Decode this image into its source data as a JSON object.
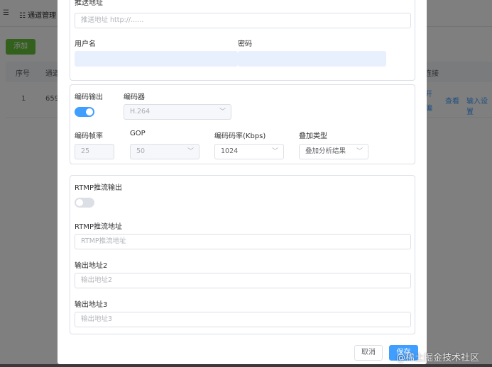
{
  "background": {
    "menu_icon": "☰",
    "tab_label": "☷ 通道管理",
    "add_button": "添加",
    "table_headers": [
      "序号",
      "通道"
    ],
    "right_header": "连接",
    "row": {
      "index": "1",
      "id_partial": "659"
    },
    "row_actions": [
      "查看",
      "输入设置"
    ],
    "right_links": [
      "开",
      "编"
    ]
  },
  "dialog": {
    "push": {
      "push_url_label": "推送地址",
      "push_url_placeholder": "推送地址 http://......",
      "username_label": "用户名",
      "password_label": "密码"
    },
    "encode": {
      "encode_output_label": "编码输出",
      "encode_output_on": true,
      "encoder_label": "编码器",
      "encoder_value": "H.264",
      "framerate_label": "编码帧率",
      "framerate_value": "25",
      "gop_label": "GOP",
      "gop_value": "50",
      "bitrate_label": "编码码率(Kbps)",
      "bitrate_value": "1024",
      "overlay_label": "叠加类型",
      "overlay_value": "叠加分析结果"
    },
    "rtmp": {
      "rtmp_output_label": "RTMP推流输出",
      "rtmp_output_on": false,
      "rtmp_url_label": "RTMP推流地址",
      "rtmp_url_placeholder": "RTMP推流地址",
      "out2_label": "输出地址2",
      "out2_placeholder": "输出地址2",
      "out3_label": "输出地址3",
      "out3_placeholder": "输出地址3"
    },
    "footer": {
      "cancel_label": "取消",
      "save_label": "保存"
    }
  },
  "watermark": "@稀土掘金技术社区",
  "colors": {
    "primary": "#409eff",
    "success": "#67c23a",
    "border": "#dcdfe6"
  }
}
